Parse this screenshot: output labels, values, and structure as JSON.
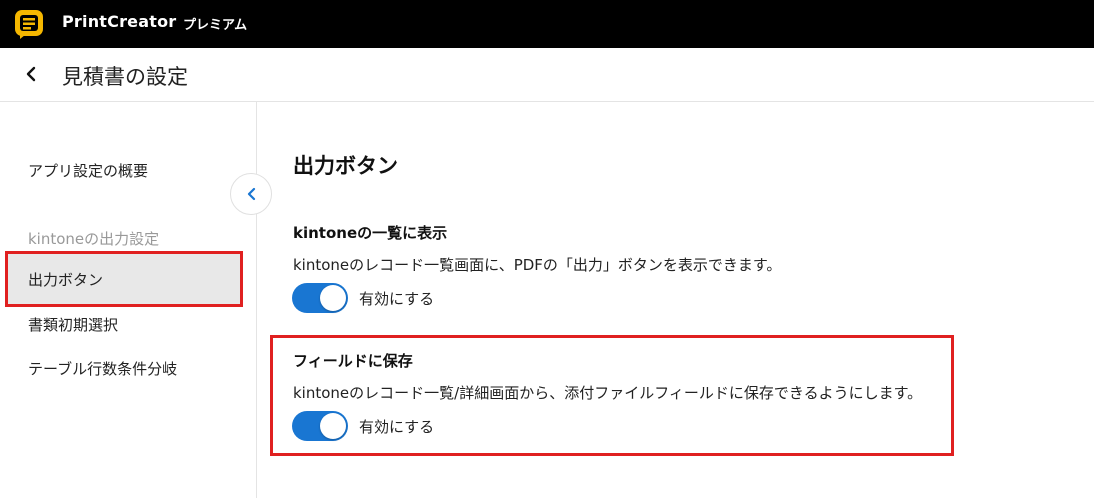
{
  "topbar": {
    "app_name": "PrintCreator",
    "plan": "プレミアム"
  },
  "header": {
    "title": "見積書の設定",
    "back_icon": "chevron-left-icon"
  },
  "sidebar": {
    "items": [
      {
        "label": "アプリ設定の概要"
      },
      {
        "label": "kintoneの出力設定"
      },
      {
        "label": "出力ボタン"
      },
      {
        "label": "書類初期選択"
      },
      {
        "label": "テーブル行数条件分岐"
      }
    ],
    "collapse_icon": "chevron-left-icon"
  },
  "main": {
    "section_title": "出力ボタン",
    "settings": [
      {
        "title": "kintoneの一覧に表示",
        "description": "kintoneのレコード一覧画面に、PDFの「出力」ボタンを表示できます。",
        "toggle_label": "有効にする",
        "enabled": true
      },
      {
        "title": "フィールドに保存",
        "description": "kintoneのレコード一覧/詳細画面から、添付ファイルフィールドに保存できるようにします。",
        "toggle_label": "有効にする",
        "enabled": true
      }
    ]
  },
  "colors": {
    "accent": "#1976d2",
    "highlight": "#e02020",
    "topbar_bg": "#000000",
    "logo": "#f5b700"
  }
}
